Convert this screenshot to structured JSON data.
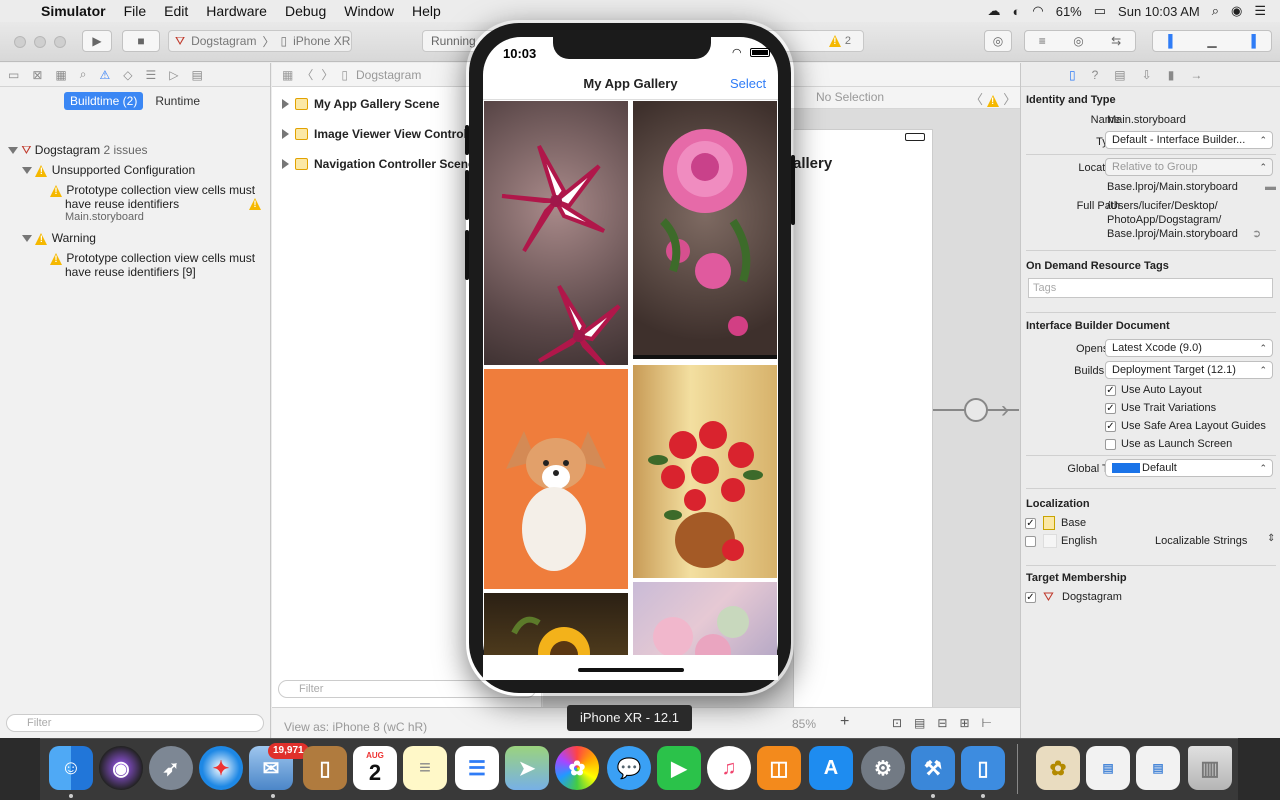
{
  "menubar": {
    "app_name": "Simulator",
    "items": [
      "File",
      "Edit",
      "Hardware",
      "Debug",
      "Window",
      "Help"
    ],
    "battery": "61%",
    "clock": "Sun 10:03 AM"
  },
  "toolbar": {
    "scheme_target": "Dogstagram",
    "scheme_device": "iPhone XR",
    "activity_status": "Running",
    "warning_count": "2"
  },
  "navigator": {
    "segments": {
      "buildtime": "Buildtime (2)",
      "runtime": "Runtime"
    },
    "project": "Dogstagram",
    "project_issues": "2 issues",
    "group1": "Unsupported Configuration",
    "issue1_line1": "Prototype collection view cells must",
    "issue1_line2": "have reuse identifiers",
    "issue1_file": "Main.storyboard",
    "group2": "Warning",
    "issue2_line1": "Prototype collection view cells must",
    "issue2_line2": "have reuse identifiers [9]",
    "filter_placeholder": "Filter"
  },
  "jumpbar": {
    "crumb": "Dogstagram",
    "no_selection": "No Selection"
  },
  "outline": {
    "scenes": [
      "My App Gallery Scene",
      "Image Viewer View Controller",
      "Navigation Controller Scene"
    ],
    "filter_placeholder": "Filter"
  },
  "canvas": {
    "title_fragment": "allery",
    "view_as": "View as: iPhone 8 (wC hR)",
    "zoom": "85%"
  },
  "inspector": {
    "identity_title": "Identity and Type",
    "name_label": "Name",
    "name_value": "Main.storyboard",
    "type_label": "Type",
    "type_value": "Default - Interface Builder...",
    "location_label": "Location",
    "location_value": "Relative to Group",
    "location_file": "Base.lproj/Main.storyboard",
    "fullpath_label": "Full Path",
    "fullpath_1": "/Users/lucifer/Desktop/",
    "fullpath_2": "PhotoApp/Dogstagram/",
    "fullpath_3": "Base.lproj/Main.storyboard",
    "odr_title": "On Demand Resource Tags",
    "tags_placeholder": "Tags",
    "ibdoc_title": "Interface Builder Document",
    "opens_label": "Opens in",
    "opens_value": "Latest Xcode (9.0)",
    "builds_label": "Builds for",
    "builds_value": "Deployment Target (12.1)",
    "checks": [
      {
        "label": "Use Auto Layout",
        "checked": true
      },
      {
        "label": "Use Trait Variations",
        "checked": true
      },
      {
        "label": "Use Safe Area Layout Guides",
        "checked": true
      },
      {
        "label": "Use as Launch Screen",
        "checked": false
      }
    ],
    "tint_label": "Global Tint",
    "tint_value": "Default",
    "tint_color": "#1a73e8",
    "loc_title": "Localization",
    "loc_base": "Base",
    "loc_english": "English",
    "loc_strings": "Localizable Strings",
    "target_title": "Target Membership",
    "target_name": "Dogstagram"
  },
  "simulator": {
    "time": "10:03",
    "nav_title": "My App Gallery",
    "select_label": "Select",
    "device_tooltip": "iPhone XR - 12.1"
  },
  "dock": {
    "mail_badge": "19,971",
    "calendar_month": "AUG",
    "calendar_day": "2"
  }
}
